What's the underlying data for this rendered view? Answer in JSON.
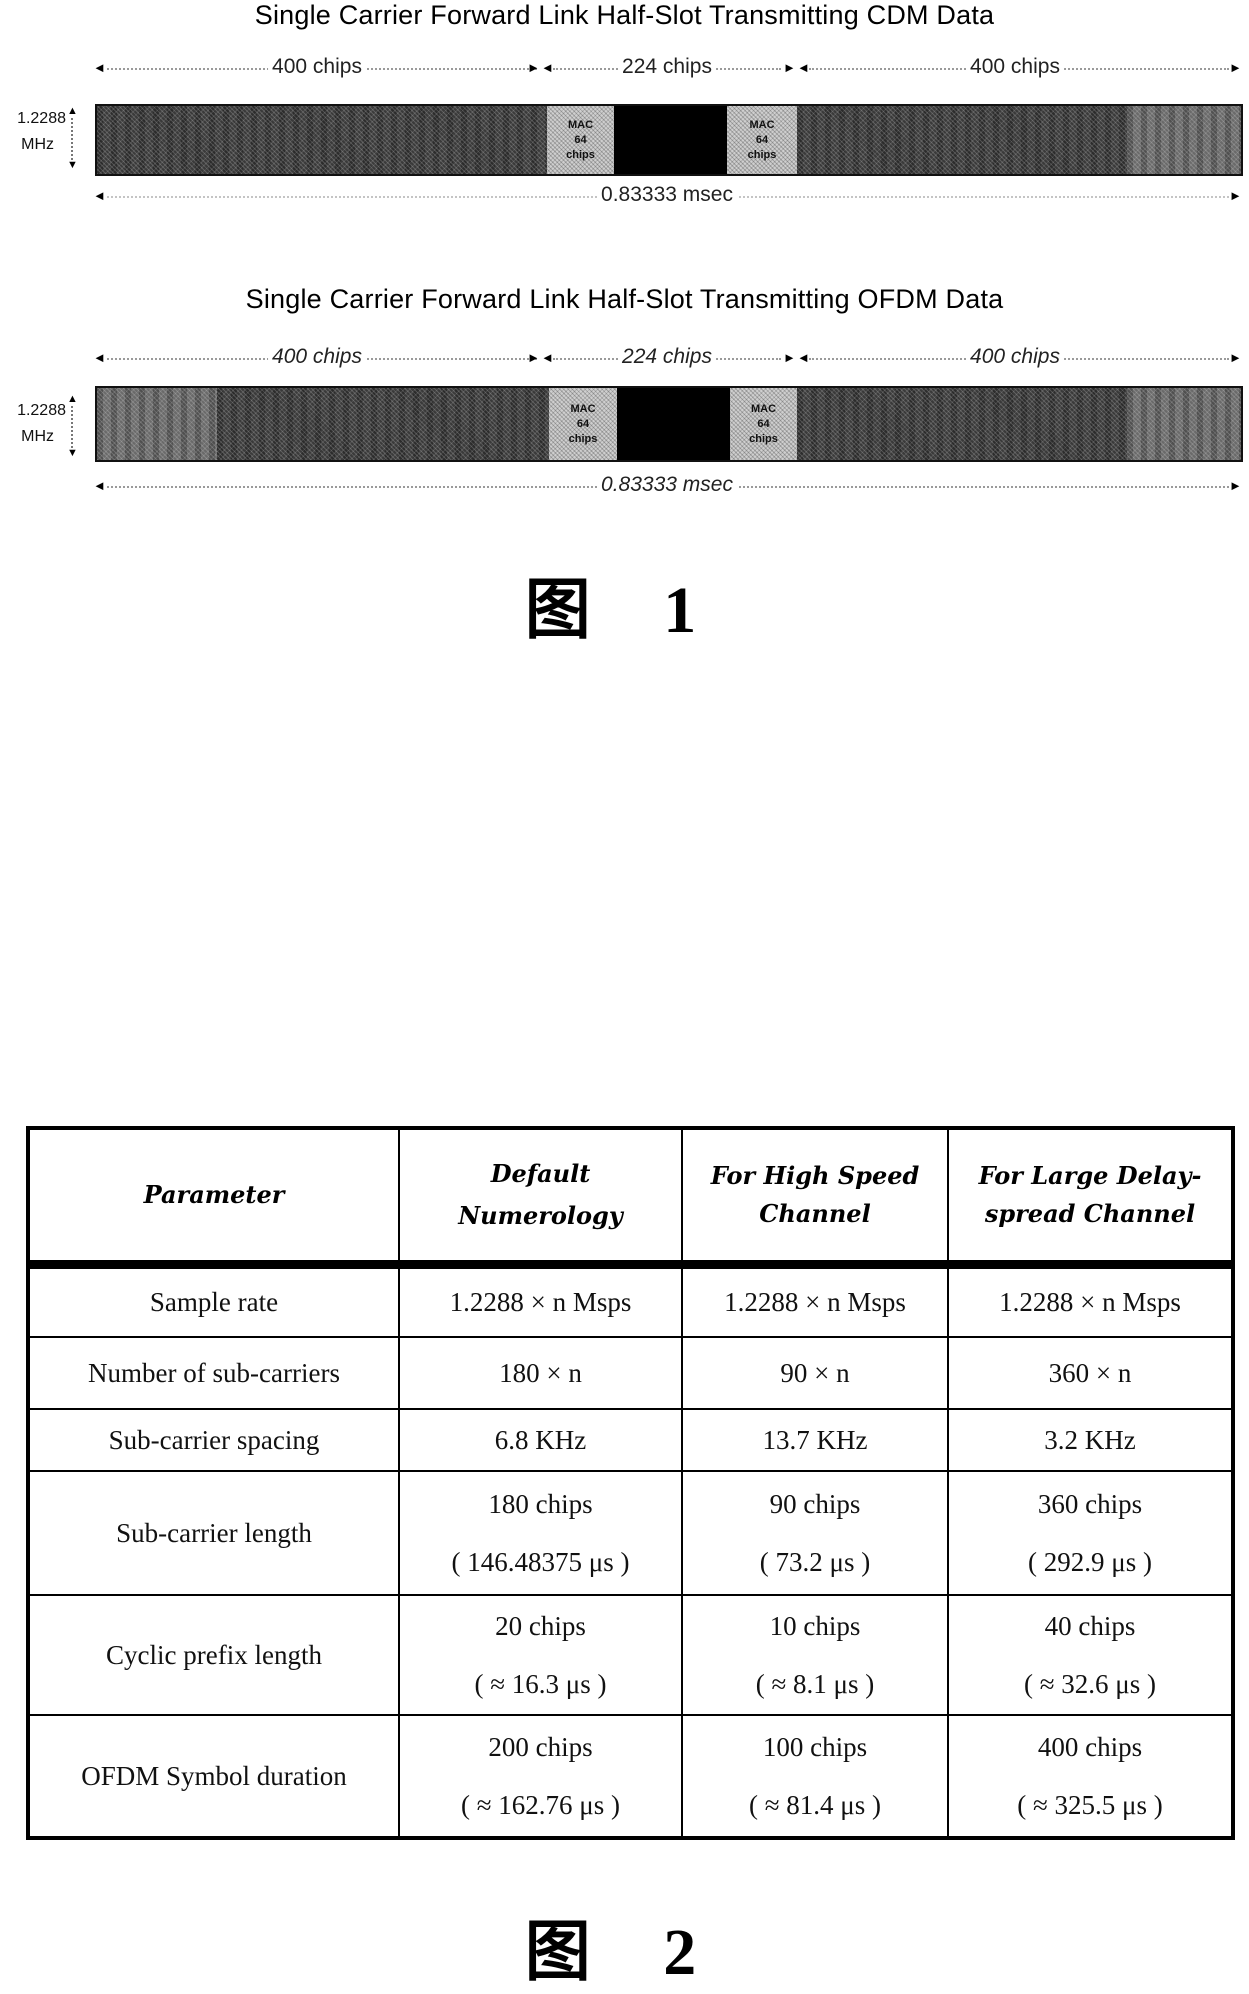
{
  "figure1": {
    "diagrams": [
      {
        "title": "Single Carrier Forward Link Half-Slot Transmitting CDM Data",
        "dimension_labels": {
          "left": "400 chips",
          "center": "224 chips",
          "right": "400 chips"
        },
        "bandwidth_label": {
          "value": "1.2288",
          "unit": "MHz"
        },
        "duration_label": "0.83333 msec",
        "segments": [
          {
            "type": "data",
            "chips": 400
          },
          {
            "type": "mac",
            "chips": 64,
            "label_lines": [
              "MAC",
              "64",
              "chips"
            ]
          },
          {
            "type": "pilot",
            "chips": 96
          },
          {
            "type": "mac",
            "chips": 64,
            "label_lines": [
              "MAC",
              "64",
              "chips"
            ]
          },
          {
            "type": "data",
            "chips": 400
          }
        ]
      },
      {
        "title": "Single Carrier Forward Link Half-Slot Transmitting OFDM Data",
        "dimension_labels": {
          "left": "400 chips",
          "center": "224 chips",
          "right": "400 chips"
        },
        "bandwidth_label": {
          "value": "1.2288",
          "unit": "MHz"
        },
        "duration_label": "0.83333 msec",
        "segments": [
          {
            "type": "data",
            "chips": 400
          },
          {
            "type": "mac",
            "chips": 64,
            "label_lines": [
              "MAC",
              "64",
              "chips"
            ]
          },
          {
            "type": "pilot",
            "chips": 96
          },
          {
            "type": "mac",
            "chips": 64,
            "label_lines": [
              "MAC",
              "64",
              "chips"
            ]
          },
          {
            "type": "data",
            "chips": 400
          }
        ]
      }
    ],
    "caption": "图 1"
  },
  "figure2": {
    "table": {
      "headers": [
        [
          "Parameter"
        ],
        [
          "Default",
          "Numerology"
        ],
        [
          "For High Speed",
          "Channel"
        ],
        [
          "For Large Delay-",
          "spread Channel"
        ]
      ],
      "rows": [
        {
          "parameter": "Sample rate",
          "default": [
            "1.2288 × n  Msps"
          ],
          "high_speed": [
            "1.2288 × n  Msps"
          ],
          "large_delay": [
            "1.2288 × n  Msps"
          ]
        },
        {
          "parameter": "Number of sub-carriers",
          "default": [
            "180 × n"
          ],
          "high_speed": [
            "90 × n"
          ],
          "large_delay": [
            "360 × n"
          ]
        },
        {
          "parameter": "Sub-carrier spacing",
          "default": [
            "6.8 KHz"
          ],
          "high_speed": [
            "13.7 KHz"
          ],
          "large_delay": [
            "3.2 KHz"
          ]
        },
        {
          "parameter": "Sub-carrier length",
          "default": [
            "180 chips",
            "( 146.48375 μs )"
          ],
          "high_speed": [
            "90 chips",
            "( 73.2 μs )"
          ],
          "large_delay": [
            "360 chips",
            "( 292.9 μs )"
          ]
        },
        {
          "parameter": "Cyclic prefix length",
          "default": [
            "20 chips",
            "( ≈ 16.3 μs )"
          ],
          "high_speed": [
            "10 chips",
            "( ≈ 8.1 μs )"
          ],
          "large_delay": [
            "40 chips",
            "( ≈ 32.6 μs )"
          ]
        },
        {
          "parameter": "OFDM Symbol duration",
          "default": [
            "200 chips",
            "( ≈ 162.76 μs )"
          ],
          "high_speed": [
            "100 chips",
            "( ≈ 81.4 μs )"
          ],
          "large_delay": [
            "400 chips",
            "( ≈ 325.5 μs )"
          ]
        }
      ]
    },
    "caption": "图 2"
  }
}
